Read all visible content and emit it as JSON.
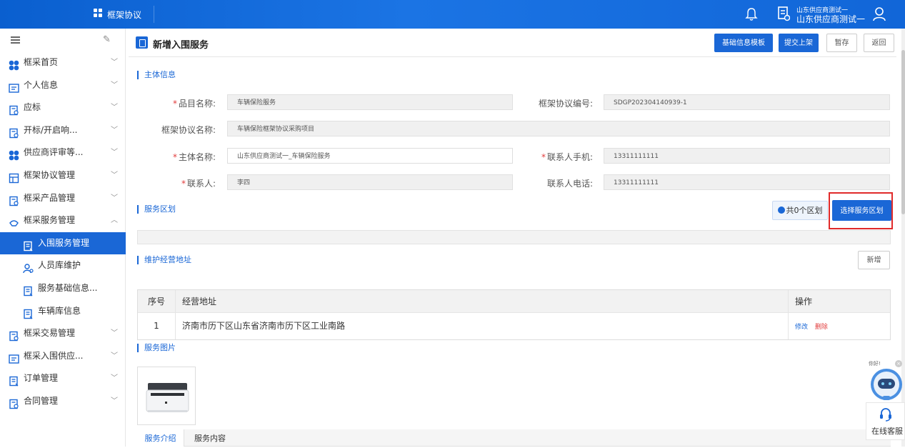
{
  "topbar": {
    "title": "框架协议",
    "user_line1": "山东供应商测试一",
    "user_line2": "山东供应商测试一"
  },
  "sidebar": {
    "items": [
      {
        "label": "框采首页",
        "icon": "clover-icon",
        "expanded": false
      },
      {
        "label": "个人信息",
        "icon": "id-card-icon",
        "expanded": false
      },
      {
        "label": "应标",
        "icon": "doc-icon",
        "expanded": false
      },
      {
        "label": "开标/开启响...",
        "icon": "doc-icon",
        "expanded": false
      },
      {
        "label": "供应商评审等...",
        "icon": "clover-icon",
        "expanded": false
      },
      {
        "label": "框架协议管理",
        "icon": "frame-icon",
        "expanded": false
      },
      {
        "label": "框采产品管理",
        "icon": "doc-icon",
        "expanded": false
      },
      {
        "label": "框采服务管理",
        "icon": "service-icon",
        "expanded": true
      }
    ],
    "sub_items": [
      {
        "label": "入围服务管理",
        "icon": "list-doc-icon",
        "active": true
      },
      {
        "label": "人员库维护",
        "icon": "person-gear-icon",
        "active": false
      },
      {
        "label": "服务基础信息...",
        "icon": "list-doc-icon",
        "active": false
      },
      {
        "label": "车辆库信息",
        "icon": "list-doc-icon",
        "active": false
      }
    ],
    "items_after": [
      {
        "label": "框采交易管理",
        "icon": "doc-icon"
      },
      {
        "label": "框采入围供应...",
        "icon": "id-card-icon"
      },
      {
        "label": "订单管理",
        "icon": "list-doc-icon"
      },
      {
        "label": "合同管理",
        "icon": "doc-icon"
      }
    ]
  },
  "page": {
    "title": "新增入围服务",
    "buttons": {
      "template": "基础信息模板",
      "submit": "提交上架",
      "draft": "暂存",
      "back": "返回"
    }
  },
  "main_info": {
    "section_title": "主体信息",
    "fields": {
      "item_name_label": "品目名称:",
      "item_name_value": "车辆保险服务",
      "agreement_no_label": "框架协议编号:",
      "agreement_no_value": "SDGP202304140939-1",
      "agreement_name_label": "框架协议名称:",
      "agreement_name_value": "车辆保险框架协议采购项目",
      "subject_name_label": "主体名称:",
      "subject_name_value": "山东供应商测试一_车辆保险服务",
      "mobile_label": "联系人手机:",
      "mobile_value": "13311111111",
      "contact_label": "联系人:",
      "contact_value": "李四",
      "phone_label": "联系人电话:",
      "phone_value": "13311111111"
    }
  },
  "service_region": {
    "section_title": "服务区划",
    "count_text": "共0个区划",
    "select_button": "选择服务区划"
  },
  "address": {
    "section_title": "维护经营地址",
    "add_button": "新增",
    "columns": [
      "序号",
      "经营地址",
      "操作"
    ],
    "rows": [
      {
        "index": "1",
        "address": "济南市历下区山东省济南市历下区工业南路",
        "edit": "修改",
        "delete": "删除"
      }
    ]
  },
  "images": {
    "section_title": "服务图片"
  },
  "tabs": [
    "服务介绍",
    "服务内容"
  ],
  "assistant": {
    "hello": "你好!",
    "service_label": "在线客服"
  },
  "colors": {
    "primary": "#1a67d6",
    "highlight": "#e02a2a",
    "required": "#e23d3d"
  }
}
